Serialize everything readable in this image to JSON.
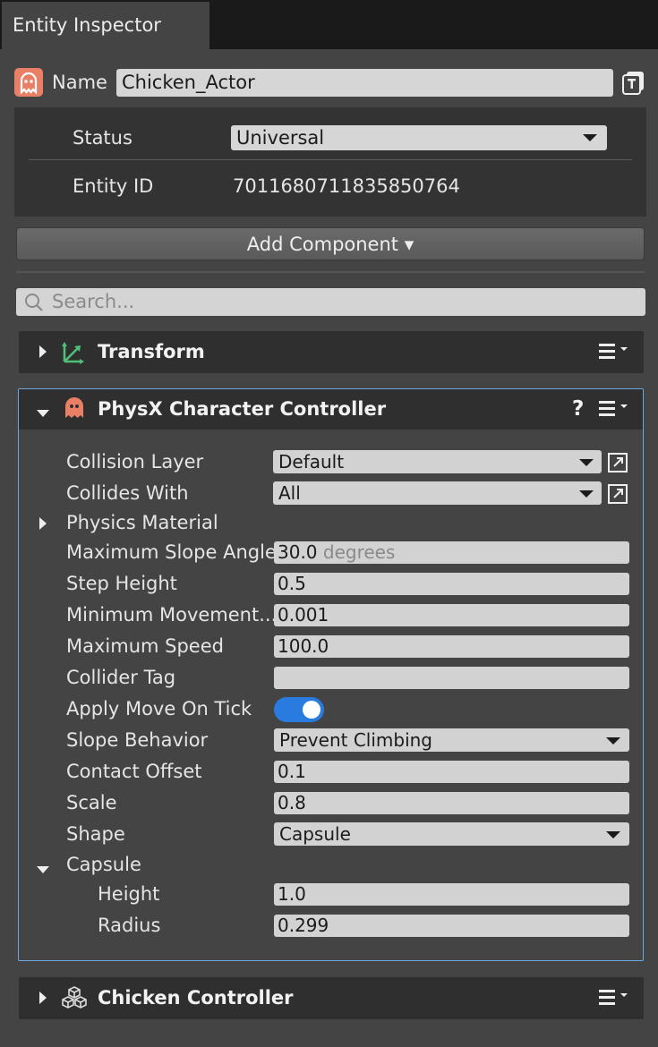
{
  "tab": {
    "title": "Entity Inspector"
  },
  "entity": {
    "name_label": "Name",
    "name_value": "Chicken_Actor",
    "status_label": "Status",
    "status_value": "Universal",
    "id_label": "Entity ID",
    "id_value": "7011680711835850764"
  },
  "add_component_label": "Add Component ▾",
  "search": {
    "placeholder": "Search..."
  },
  "components": {
    "transform": {
      "title": "Transform"
    },
    "physx": {
      "title": "PhysX Character Controller",
      "help": "?",
      "properties": {
        "collision_layer": {
          "label": "Collision Layer",
          "value": "Default"
        },
        "collides_with": {
          "label": "Collides With",
          "value": "All"
        },
        "physics_material": {
          "label": "Physics Material"
        },
        "max_slope_angle": {
          "label": "Maximum Slope Angle",
          "value": "30.0",
          "unit": "degrees"
        },
        "step_height": {
          "label": "Step Height",
          "value": "0.5"
        },
        "min_movement": {
          "label": "Minimum Movement...",
          "value": "0.001"
        },
        "max_speed": {
          "label": "Maximum Speed",
          "value": "100.0"
        },
        "collider_tag": {
          "label": "Collider Tag",
          "value": ""
        },
        "apply_move_on_tick": {
          "label": "Apply Move On Tick",
          "checked": true
        },
        "slope_behavior": {
          "label": "Slope Behavior",
          "value": "Prevent Climbing"
        },
        "contact_offset": {
          "label": "Contact Offset",
          "value": "0.1"
        },
        "scale": {
          "label": "Scale",
          "value": "0.8"
        },
        "shape": {
          "label": "Shape",
          "value": "Capsule"
        },
        "capsule": {
          "label": "Capsule"
        },
        "height": {
          "label": "Height",
          "value": "1.0"
        },
        "radius": {
          "label": "Radius",
          "value": "0.299"
        }
      }
    },
    "chicken_controller": {
      "title": "Chicken Controller"
    }
  },
  "colors": {
    "background": "#444444",
    "header": "#2f2f2f",
    "accent_border": "#6da9dc",
    "toggle_on": "#2a7be0",
    "entity_icon": "#e98065",
    "transform_icon": "#4fbf7a"
  }
}
